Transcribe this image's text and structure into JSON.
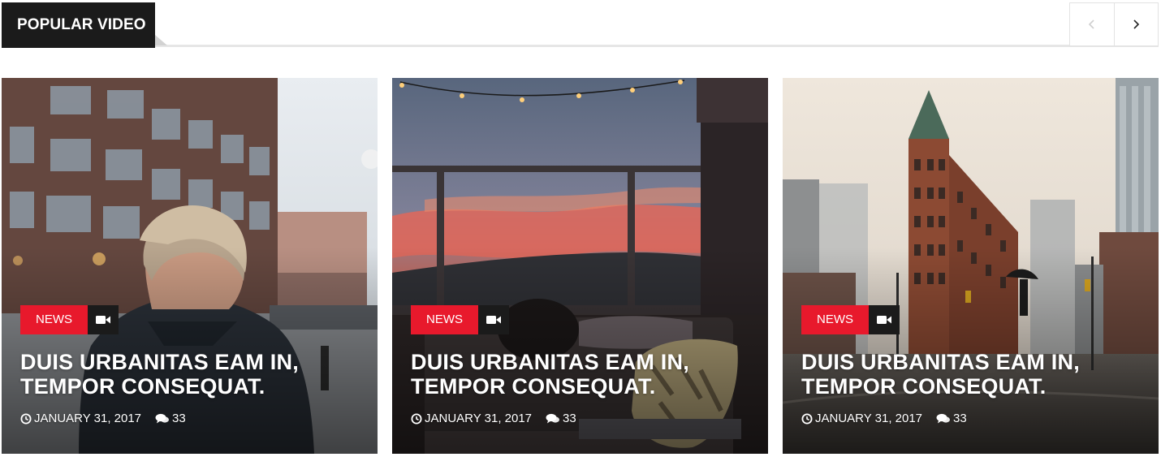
{
  "header": {
    "title": "POPULAR VIDEO",
    "prev_icon": "chevron-left-icon",
    "next_icon": "chevron-right-icon"
  },
  "colors": {
    "accent": "#e8192c",
    "dark": "#1b1b1b",
    "divider": "#e6e6e6"
  },
  "cards": [
    {
      "category": "NEWS",
      "media_icon": "video-camera-icon",
      "title": "DUIS URBANITAS EAM IN, TEMPOR CONSEQUAT.",
      "date": "JANUARY 31, 2017",
      "comments": "33",
      "image": "man-with-undercut-on-city-street"
    },
    {
      "category": "NEWS",
      "media_icon": "video-camera-icon",
      "title": "DUIS URBANITAS EAM IN, TEMPOR CONSEQUAT.",
      "date": "JANUARY 31, 2017",
      "comments": "33",
      "image": "person-on-couch-sunset-balcony"
    },
    {
      "category": "NEWS",
      "media_icon": "video-camera-icon",
      "title": "DUIS URBANITAS EAM IN, TEMPOR CONSEQUAT.",
      "date": "JANUARY 31, 2017",
      "comments": "33",
      "image": "flatiron-building-rainy-city"
    }
  ]
}
